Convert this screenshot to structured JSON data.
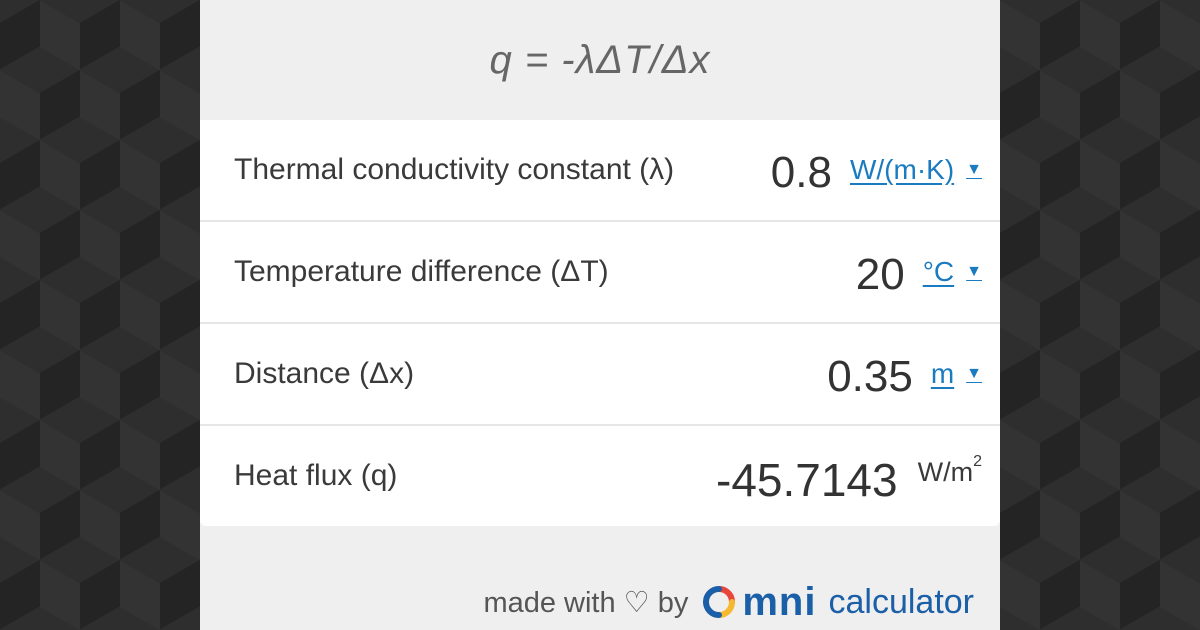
{
  "formula": "q = -λΔT/Δx",
  "rows": [
    {
      "label": "Thermal conductivity constant (λ)",
      "value": "0.8",
      "unit": "W/(m·K)"
    },
    {
      "label": "Temperature difference (ΔT)",
      "value": "20",
      "unit": "°C"
    },
    {
      "label": "Distance (Δx)",
      "value": "0.35",
      "unit": "m"
    }
  ],
  "result": {
    "label": "Heat flux (q)",
    "value": "-45.7143",
    "unit": "W/m",
    "unit_sup": "2"
  },
  "footer": {
    "made_with": "made with ♡ by",
    "brand": "mni",
    "brand_suffix": "calculator"
  },
  "colors": {
    "accent": "#1b7bc0",
    "brand": "#1b5fa8"
  },
  "icons": {
    "caret": "▼"
  }
}
